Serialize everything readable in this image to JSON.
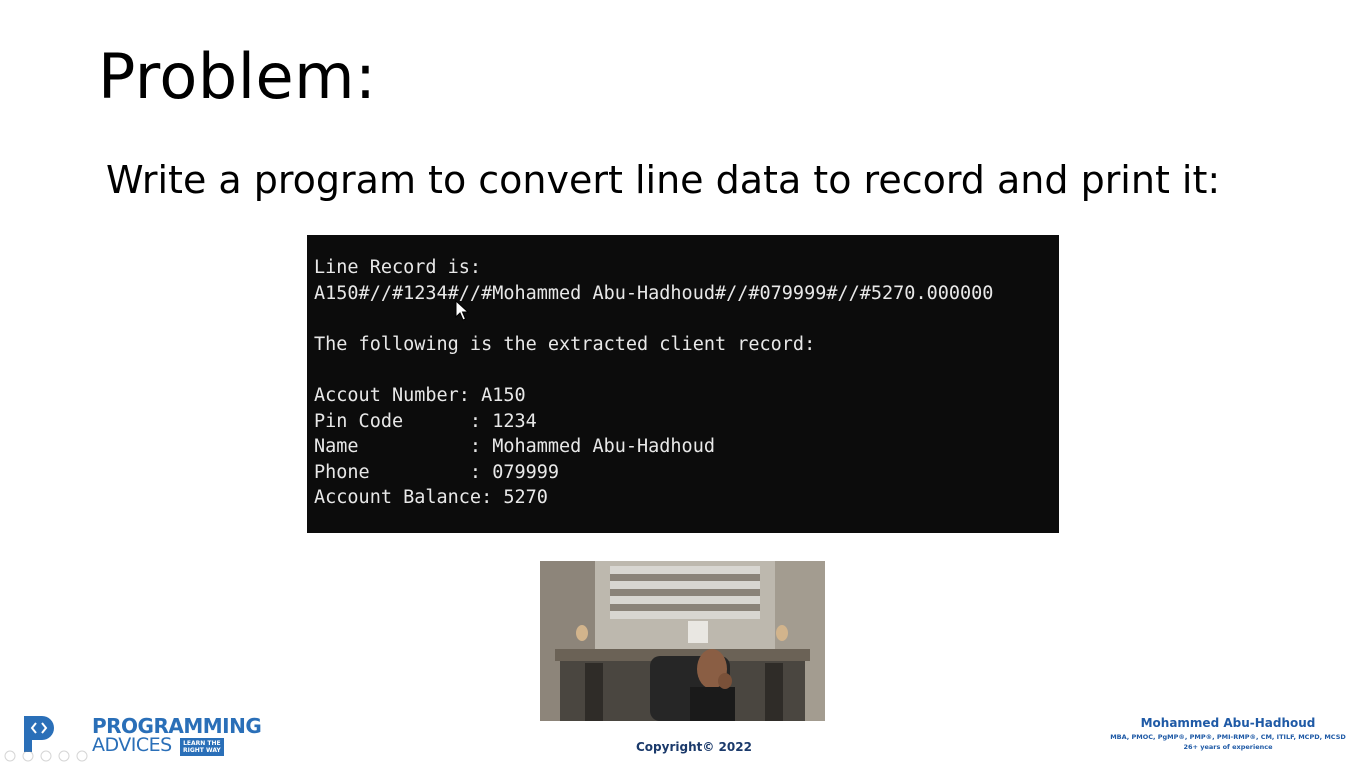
{
  "slide": {
    "title": "Problem:",
    "subtitle": "Write a program to convert line data to record and print it:"
  },
  "console": {
    "lines": [
      "Line Record is:",
      "A150#//#1234#//#Mohammed Abu-Hadhoud#//#079999#//#5270.000000",
      "",
      "The following is the extracted client record:",
      "",
      "Accout Number: A150",
      "Pin Code      : 1234",
      "Name          : Mohammed Abu-Hadhoud",
      "Phone         : 079999",
      "Account Balance: 5270"
    ]
  },
  "logo": {
    "line1": "PROGRAMMING",
    "line2": "ADVICES",
    "badge_line1": "LEARN THE",
    "badge_line2": "RIGHT WAY",
    "brand_color": "#2a6fb8"
  },
  "footer": {
    "copyright": "Copyright© 2022",
    "author_name": "Mohammed Abu-Hadhoud",
    "author_credentials": "MBA, PMOC, PgMP®, PMP®, PMI-RMP®, CM, ITILF, MCPD, MCSD",
    "author_experience": "26+ years of experience"
  },
  "icons": {
    "cursor": "mouse-pointer-icon",
    "logo_mark": "programming-advices-logo-icon"
  }
}
